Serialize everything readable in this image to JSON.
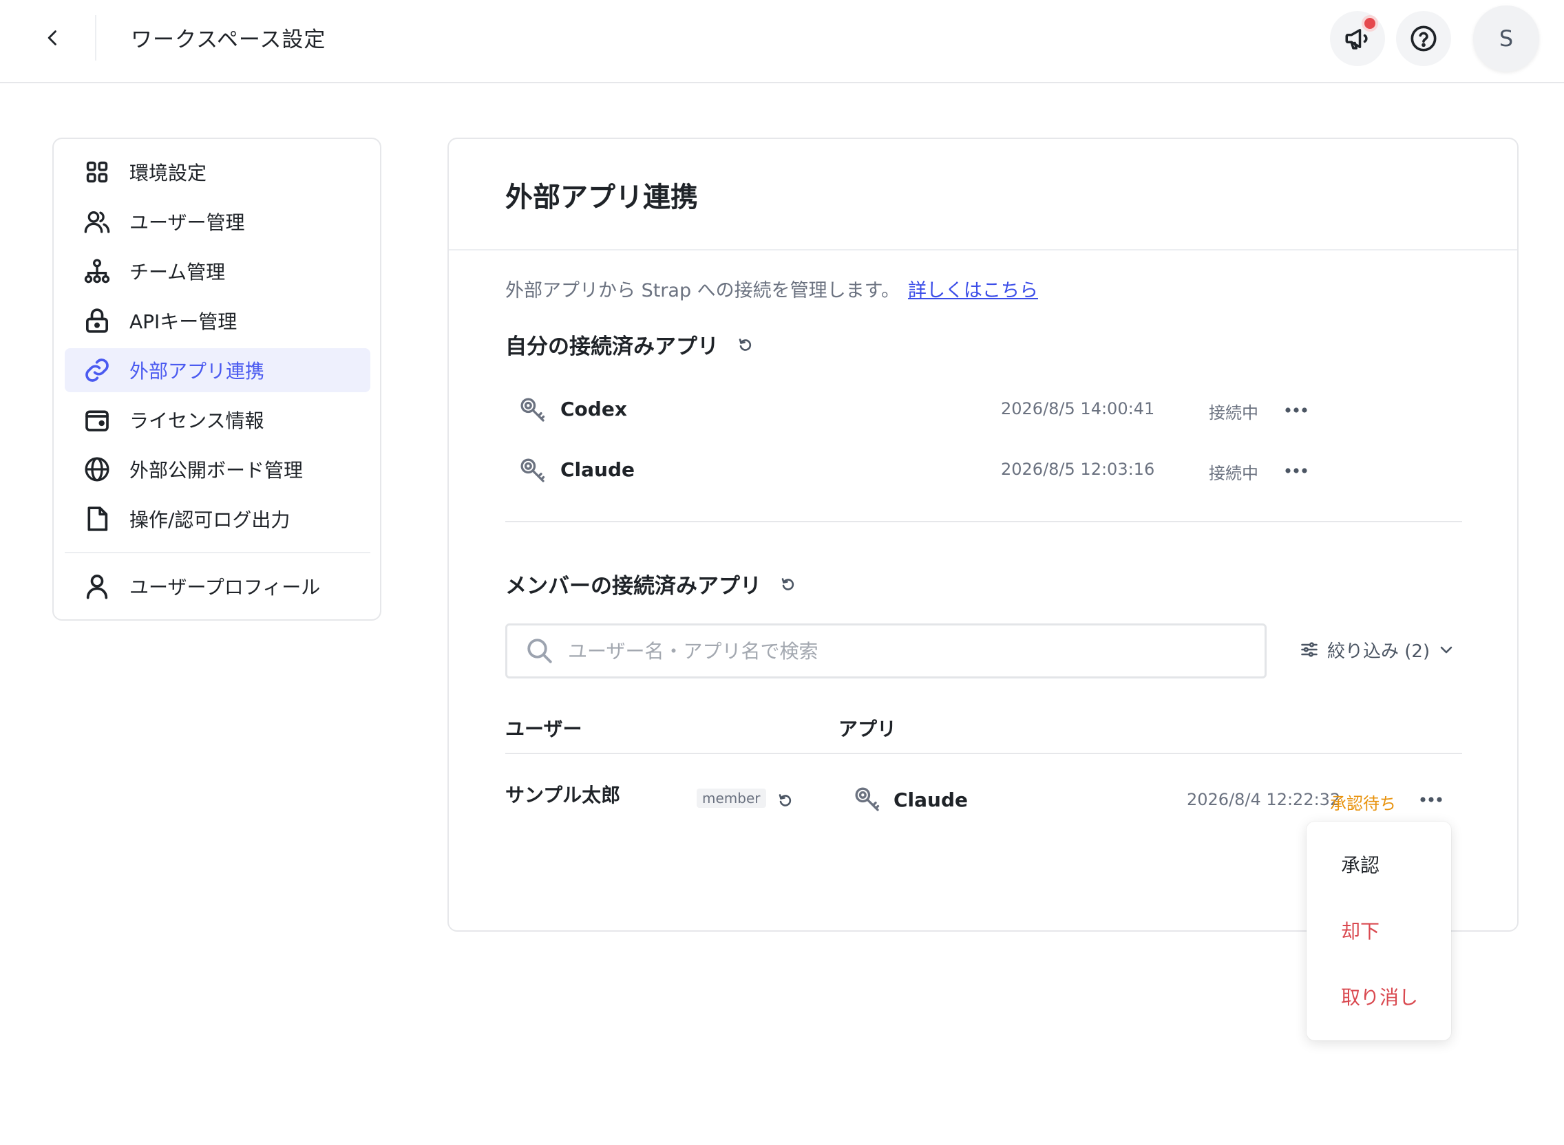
{
  "header": {
    "title": "ワークスペース設定",
    "avatar_initial": "S"
  },
  "sidebar": {
    "items": [
      {
        "label": "環境設定",
        "icon": "grid-icon"
      },
      {
        "label": "ユーザー管理",
        "icon": "users-icon"
      },
      {
        "label": "チーム管理",
        "icon": "org-chart-icon"
      },
      {
        "label": "APIキー管理",
        "icon": "lock-icon"
      },
      {
        "label": "外部アプリ連携",
        "icon": "link-icon",
        "active": true
      },
      {
        "label": "ライセンス情報",
        "icon": "wallet-icon"
      },
      {
        "label": "外部公開ボード管理",
        "icon": "globe-icon"
      },
      {
        "label": "操作/認可ログ出力",
        "icon": "file-icon"
      }
    ],
    "profile_item": {
      "label": "ユーザープロフィール",
      "icon": "user-icon"
    }
  },
  "main": {
    "title": "外部アプリ連携",
    "description": "外部アプリから Strap への接続を管理します。",
    "learn_more_link": "詳しくはこちら",
    "my_apps": {
      "title": "自分の接続済みアプリ",
      "rows": [
        {
          "app": "Codex",
          "timestamp": "2026/8/5 14:00:41",
          "status": "接続中"
        },
        {
          "app": "Claude",
          "timestamp": "2026/8/5 12:03:16",
          "status": "接続中"
        }
      ]
    },
    "member_apps": {
      "title": "メンバーの接続済みアプリ",
      "search_placeholder": "ユーザー名・アプリ名で検索",
      "filter_label": "絞り込み (2)",
      "columns": {
        "user": "ユーザー",
        "app": "アプリ"
      },
      "rows": [
        {
          "user": "サンプル太郎",
          "role": "member",
          "app": "Claude",
          "timestamp": "2026/8/4 12:22:32",
          "status": "承認待ち"
        }
      ]
    },
    "row_menu": {
      "approve": "承認",
      "reject": "却下",
      "revoke": "取り消し"
    }
  },
  "colors": {
    "accent": "#4a5af0",
    "active_bg": "#eef0fd",
    "pending": "#e8920c",
    "danger": "#d9484f",
    "notification": "#e5484d"
  }
}
